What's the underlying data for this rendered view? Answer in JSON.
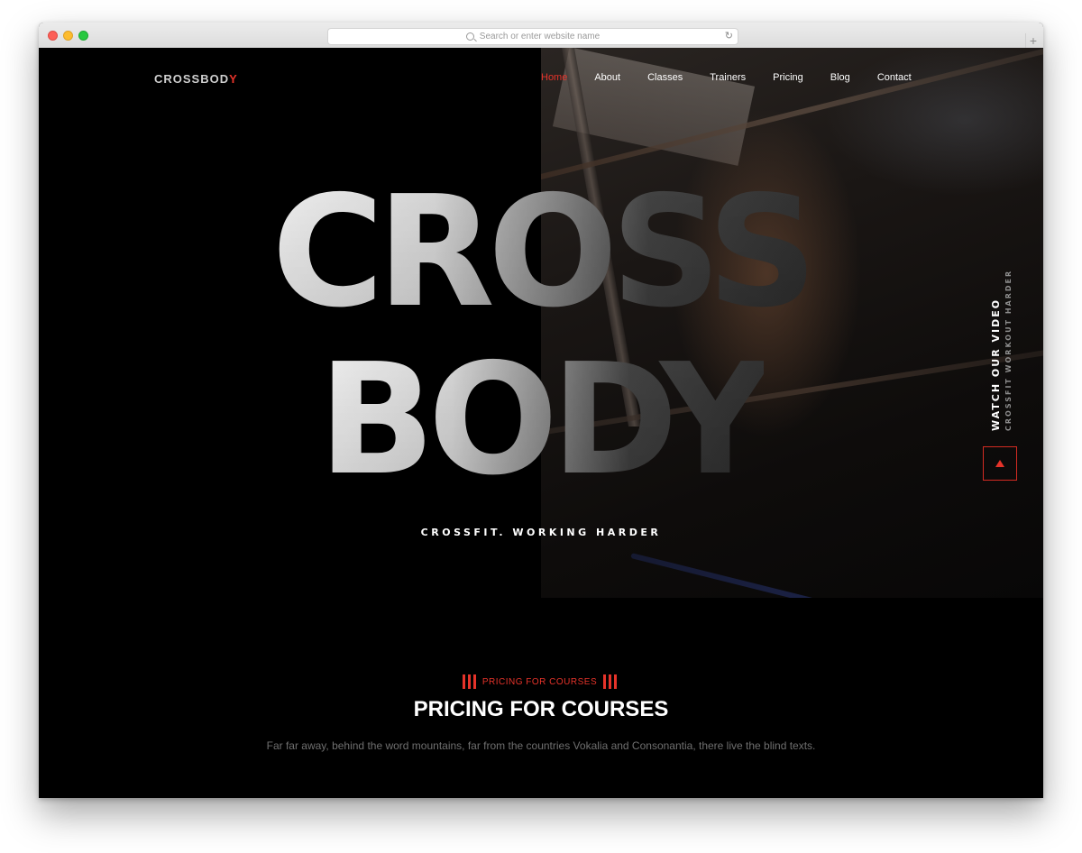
{
  "browser": {
    "url_placeholder": "Search or enter website name",
    "new_tab_symbol": "+",
    "reload_symbol": "↻"
  },
  "brand": {
    "logo_main": "CROSSBOD",
    "logo_accent": "Y",
    "accent_color": "#e5332a"
  },
  "nav": {
    "items": [
      "Home",
      "About",
      "Classes",
      "Trainers",
      "Pricing",
      "Blog",
      "Contact"
    ],
    "active": "Home"
  },
  "hero": {
    "title_line1": "CROSS",
    "title_line2": "BODY",
    "tagline": "CROSSFIT. WORKING HARDER",
    "video_title": "WATCH OUR VIDEO",
    "video_subtitle": "CROSSFIT WORKOUT HARDER"
  },
  "pricing": {
    "tag": "PRICING FOR COURSES",
    "title": "PRICING FOR COURSES",
    "description": "Far far away, behind the word mountains, far from the countries Vokalia and Consonantia, there live the blind texts."
  }
}
